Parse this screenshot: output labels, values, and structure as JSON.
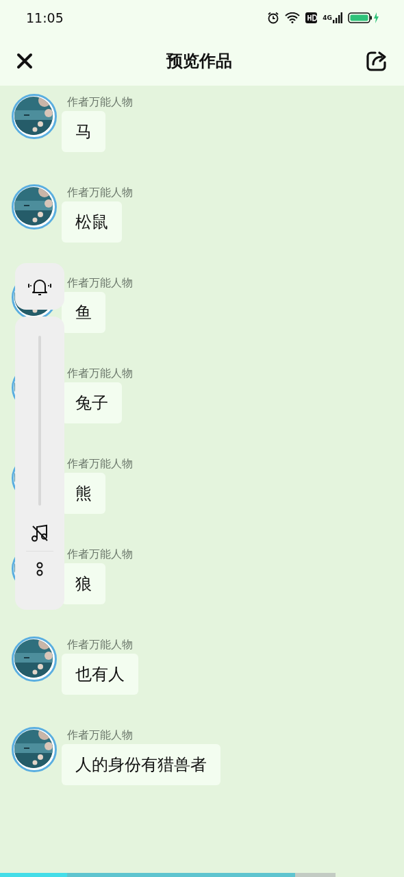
{
  "status_bar": {
    "time": "11:05",
    "network": "4G"
  },
  "header": {
    "title": "预览作品"
  },
  "messages": [
    {
      "author": "作者万能人物",
      "text": "马"
    },
    {
      "author": "作者万能人物",
      "text": "松鼠"
    },
    {
      "author": "作者万能人物",
      "text": "鱼"
    },
    {
      "author": "作者万能人物",
      "text": "兔子"
    },
    {
      "author": "作者万能人物",
      "text": "熊"
    },
    {
      "author": "作者万能人物",
      "text": "狼"
    },
    {
      "author": "作者万能人物",
      "text": "也有人"
    },
    {
      "author": "作者万能人物",
      "text": "人的身份有猎兽者"
    }
  ],
  "playback": {
    "level": 0.88
  }
}
